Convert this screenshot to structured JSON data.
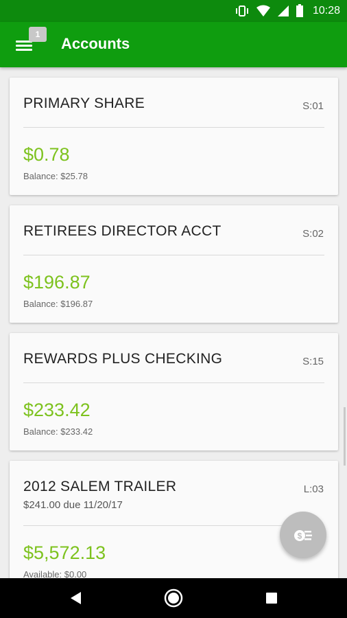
{
  "status_bar": {
    "time": "10:28",
    "icons": [
      "vibrate-icon",
      "wifi-icon",
      "signal-icon",
      "battery-icon"
    ]
  },
  "app_bar": {
    "title": "Accounts",
    "menu_badge": "1",
    "background_color": "#0f9d0f"
  },
  "accounts": [
    {
      "name": "PRIMARY SHARE",
      "code": "S:01",
      "amount": "$0.78",
      "balance_label": "Balance: $25.78"
    },
    {
      "name": "RETIREES DIRECTOR ACCT",
      "code": "S:02",
      "amount": "$196.87",
      "balance_label": "Balance: $196.87"
    },
    {
      "name": "REWARDS PLUS CHECKING",
      "code": "S:15",
      "amount": "$233.42",
      "balance_label": "Balance: $233.42"
    },
    {
      "name": "2012 SALEM TRAILER",
      "code": "L:03",
      "due": "$241.00 due 11/20/17",
      "amount": "$5,572.13",
      "balance_label": "Available: $0.00"
    }
  ],
  "colors": {
    "amount": "#7dc21e",
    "status_bar": "#0d8a0d",
    "fab": "#bdbdbd"
  },
  "fab": {
    "icon": "pay-money-icon"
  },
  "nav_bar": {
    "icons": [
      "back-icon",
      "home-icon",
      "recents-icon"
    ]
  }
}
